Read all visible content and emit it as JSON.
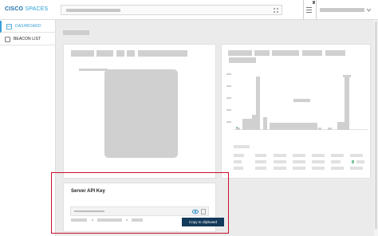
{
  "app": {
    "brand_part1": "CISCO",
    "brand_part2": "SPACES"
  },
  "sidebar": {
    "items": [
      {
        "label": "DASHBOARD",
        "active": true,
        "icon": "dashboard-icon"
      },
      {
        "label": "BEACON LIST",
        "active": false,
        "icon": "beacon-icon"
      }
    ]
  },
  "api_card": {
    "title": "Server API Key",
    "copy_label": "Copy to clipboard"
  },
  "colors": {
    "accent": "#3aa0d8",
    "brand_dark": "#1a6fa8",
    "button_bg": "#133a5a",
    "highlight": "#c8102e"
  }
}
